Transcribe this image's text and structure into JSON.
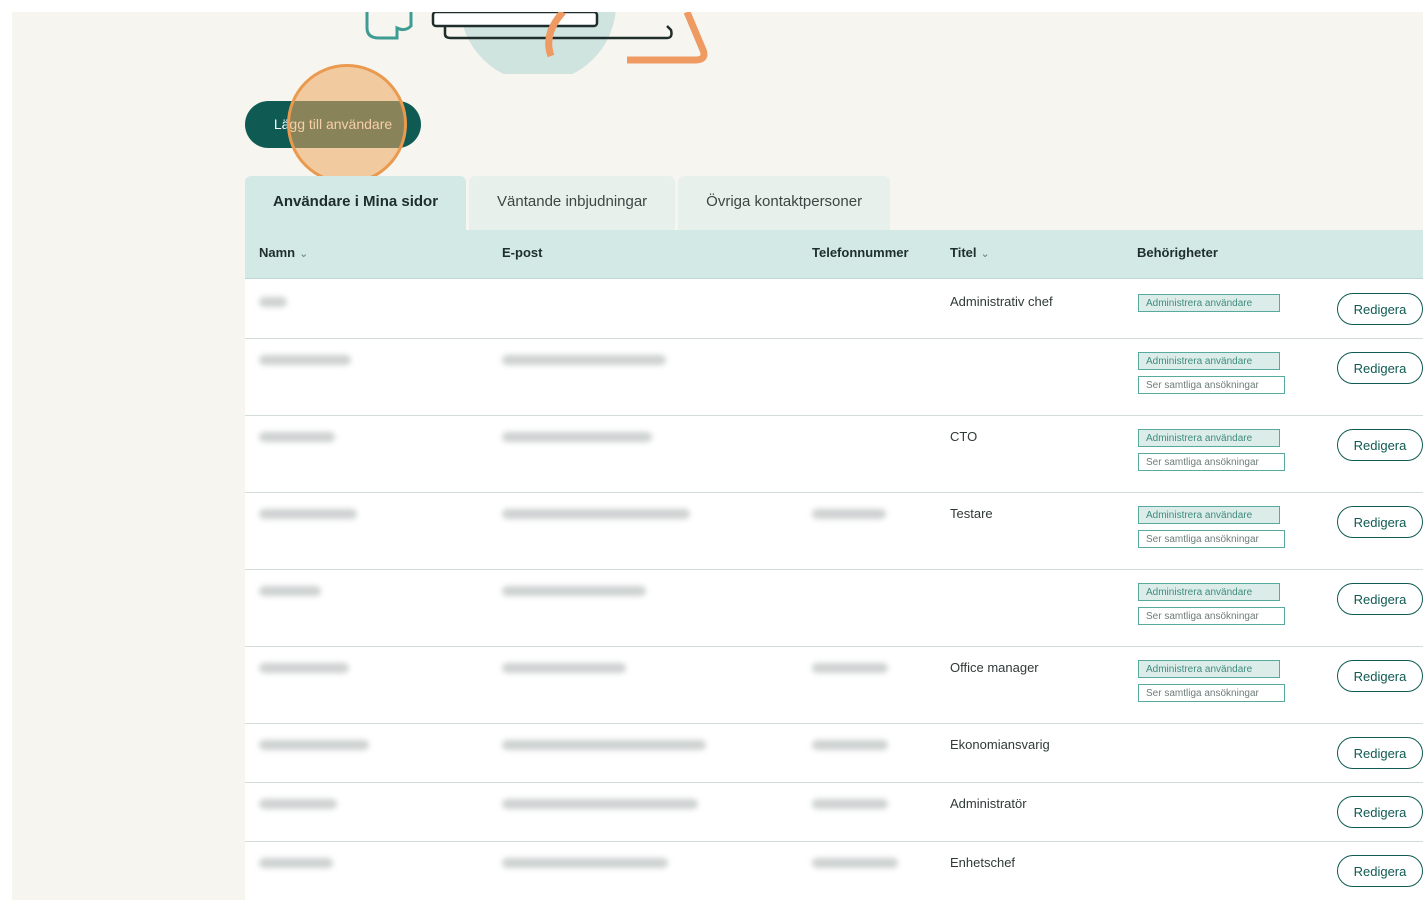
{
  "actions": {
    "add_user_label": "Lägg till användare"
  },
  "tabs": [
    {
      "label": "Användare i Mina sidor",
      "active": true
    },
    {
      "label": "Väntande inbjudningar",
      "active": false
    },
    {
      "label": "Övriga kontaktpersoner",
      "active": false
    }
  ],
  "table": {
    "headers": {
      "name": "Namn",
      "email": "E-post",
      "phone": "Telefonnummer",
      "title": "Titel",
      "permissions": "Behörigheter"
    },
    "permission_labels": {
      "admin": "Administrera användare",
      "view_all": "Ser samtliga ansökningar"
    },
    "edit_label": "Redigera",
    "rows": [
      {
        "title": "Administrativ chef",
        "perms": [
          "admin"
        ]
      },
      {
        "title": "",
        "perms": [
          "admin",
          "view_all"
        ]
      },
      {
        "title": "CTO",
        "perms": [
          "admin",
          "view_all"
        ]
      },
      {
        "title": "Testare",
        "perms": [
          "admin",
          "view_all"
        ]
      },
      {
        "title": "",
        "perms": [
          "admin",
          "view_all"
        ]
      },
      {
        "title": "Office manager",
        "perms": [
          "admin",
          "view_all"
        ]
      },
      {
        "title": "Ekonomiansvarig",
        "perms": []
      },
      {
        "title": "Administratör",
        "perms": []
      },
      {
        "title": "Enhetschef",
        "perms": []
      }
    ]
  },
  "colors": {
    "primary": "#0f5a52",
    "header_bg": "#d2e9e6",
    "highlight": "#ea9a4f",
    "page_bg": "#f6f5f0"
  }
}
